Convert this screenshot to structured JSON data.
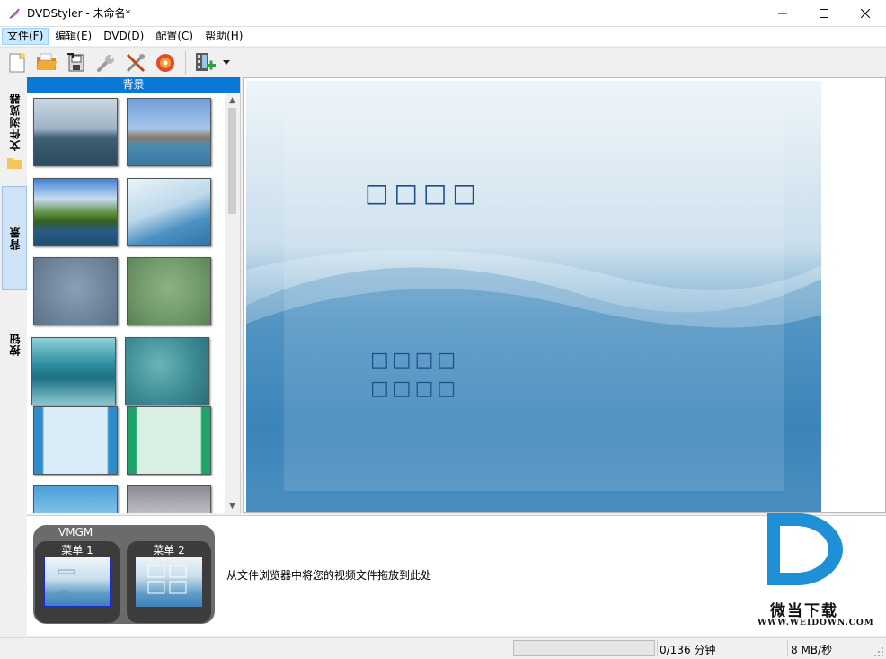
{
  "window": {
    "title": "DVDStyler - 未命名*",
    "minimize_icon": "minimize-icon",
    "maximize_icon": "maximize-icon",
    "close_icon": "close-icon"
  },
  "menubar": {
    "items": [
      {
        "label": "文件(F)",
        "active": true
      },
      {
        "label": "编辑(E)"
      },
      {
        "label": "DVD(D)"
      },
      {
        "label": "配置(C)"
      },
      {
        "label": "帮助(H)"
      }
    ]
  },
  "toolbar": {
    "icons": [
      "new-file-icon",
      "open-folder-icon",
      "save-icon",
      "settings-wrench-icon",
      "tools-icon",
      "burn-disc-icon",
      "add-video-icon",
      "dropdown-arrow-icon"
    ]
  },
  "side_tabs": {
    "file_browser": "文件浏览器",
    "background": "背景",
    "buttons": "按钮"
  },
  "background_panel": {
    "header": "背景"
  },
  "canvas": {
    "title_glyphs": "□□□□",
    "button1_glyphs": "□□□□",
    "button2_glyphs": "□□□□"
  },
  "titleset": {
    "vmgm_label": "VMGM",
    "menu1_label": "菜单 1",
    "menu2_label": "菜单 2",
    "drop_hint": "从文件浏览器中将您的视频文件拖放到此处"
  },
  "statusbar": {
    "duration": "0/136 分钟",
    "rate": "8 MB/秒"
  },
  "watermark": {
    "cn": "微当下载",
    "url": "WWW.WEIDOWN.COM"
  },
  "colors": {
    "accent": "#0a78d7",
    "canvas_blue": "#4a8fbf",
    "canvas_text": "#1b4f8a"
  }
}
